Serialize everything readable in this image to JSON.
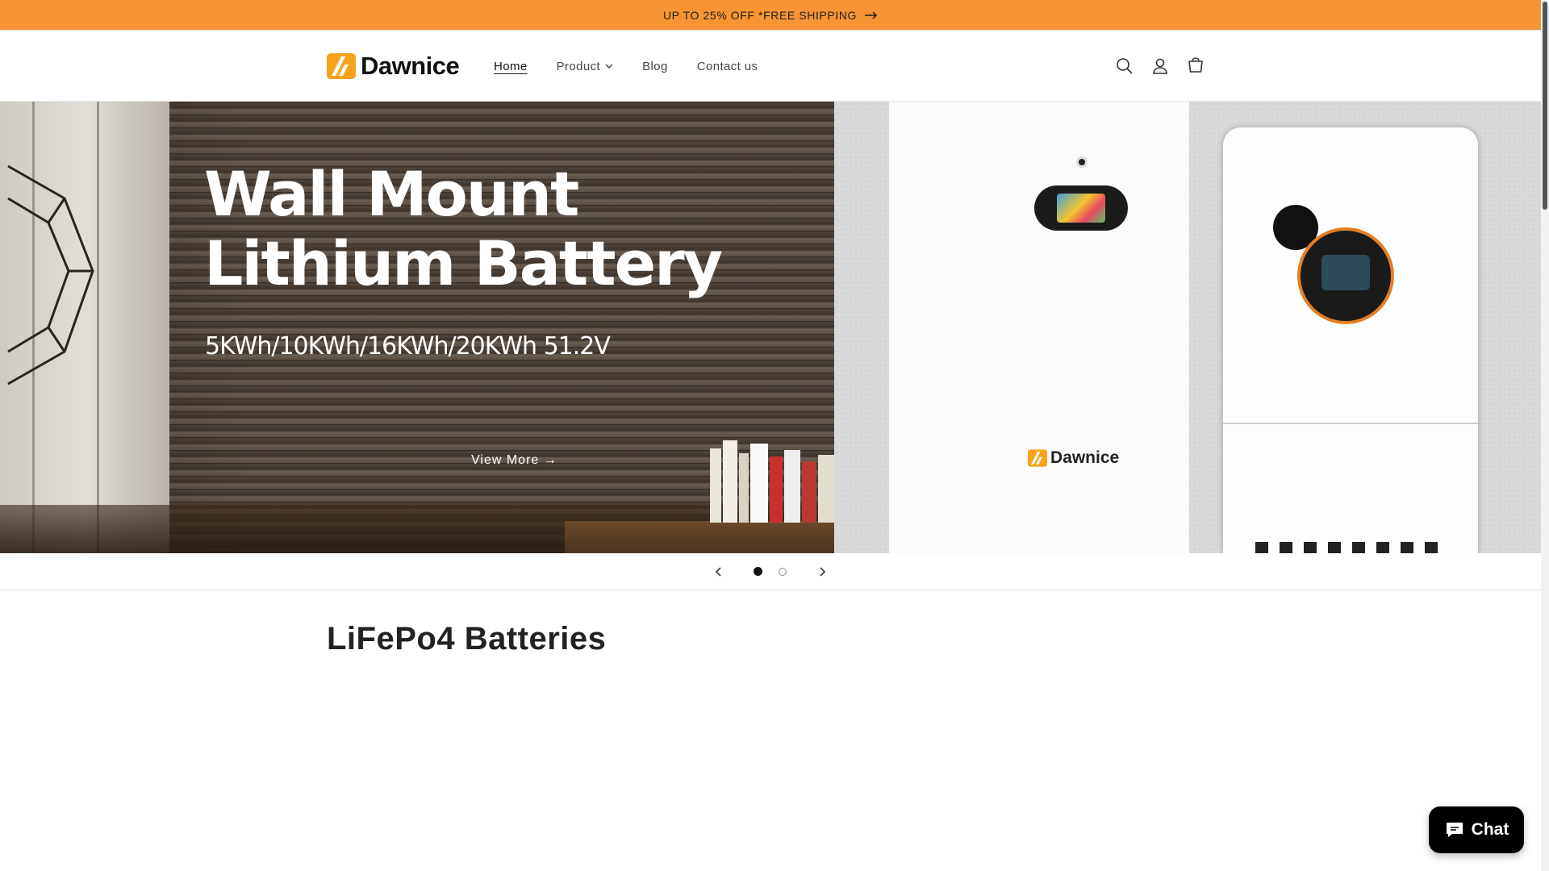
{
  "announcement": {
    "text": "UP TO 25% OFF *FREE SHIPPING"
  },
  "brand": {
    "name": "Dawnice",
    "accent": "#f79433"
  },
  "nav": {
    "items": [
      {
        "label": "Home",
        "active": true
      },
      {
        "label": "Product",
        "dropdown": true
      },
      {
        "label": "Blog"
      },
      {
        "label": "Contact us"
      }
    ]
  },
  "header_icons": [
    "search-icon",
    "account-icon",
    "cart-icon"
  ],
  "hero": {
    "title": "Wall Mount\nLithium Battery",
    "subtitle": "5KWh/10KWh/16KWh/20KWh 51.2V",
    "cta": "View More →",
    "panel_brand": "Dawnice"
  },
  "slider": {
    "slides": 2,
    "current": 1
  },
  "section": {
    "title": "LiFePo4 Batteries"
  },
  "chat": {
    "label": "Chat"
  }
}
